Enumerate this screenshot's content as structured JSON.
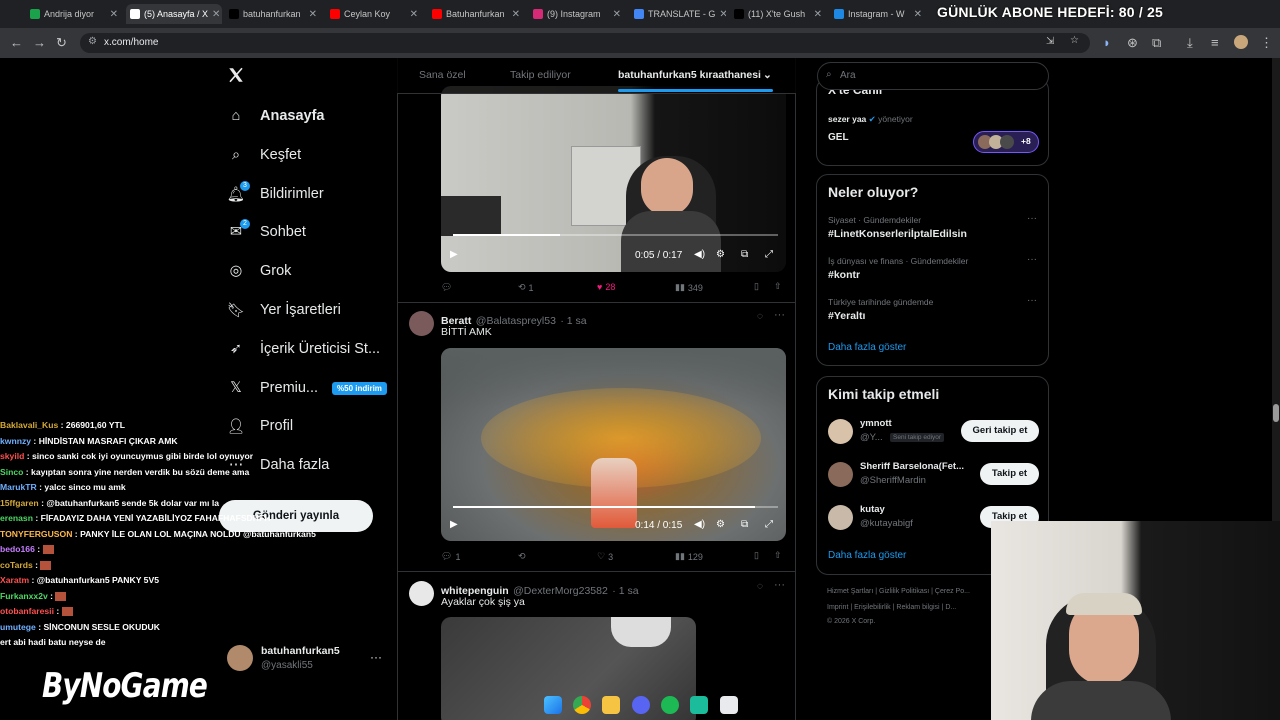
{
  "browser": {
    "tabs": [
      {
        "label": "Andrija diyor",
        "color": "#1aa34a"
      },
      {
        "label": "(5) Anasayfa / X",
        "color": "#ffffff",
        "active": true
      },
      {
        "label": "batuhanfurkan",
        "color": "#000000"
      },
      {
        "label": "Ceylan Koy",
        "color": "#ff0000"
      },
      {
        "label": "Batuhanfurkan",
        "color": "#ff0000"
      },
      {
        "label": "(9) Instagram",
        "color": "#d62976"
      },
      {
        "label": "TRANSLATE - G",
        "color": "#4285f4"
      },
      {
        "label": "(11) X'te Gush",
        "color": "#000000"
      },
      {
        "label": "Instagram - W",
        "color": "#1e88e5"
      }
    ],
    "url": "x.com/home",
    "overlay_goal": "GÜNLÜK ABONE HEDEFİ: 80 / 25"
  },
  "nav": {
    "items": [
      {
        "label": "Anasayfa",
        "icon": "home-icon"
      },
      {
        "label": "Keşfet",
        "icon": "search-icon"
      },
      {
        "label": "Bildirimler",
        "icon": "bell-icon",
        "count": "3"
      },
      {
        "label": "Sohbet",
        "icon": "chat-icon",
        "count": "2"
      },
      {
        "label": "Grok",
        "icon": "grok-icon"
      },
      {
        "label": "Yer İşaretleri",
        "icon": "bookmark-icon"
      },
      {
        "label": "İçerik Üreticisi St...",
        "icon": "rocket-icon"
      },
      {
        "label": "Premiu...",
        "icon": "x-icon",
        "badge": "%50 indirim"
      },
      {
        "label": "Profil",
        "icon": "person-icon"
      },
      {
        "label": "Daha fazla",
        "icon": "more-icon"
      }
    ],
    "post_button": "Gönderi yayınla",
    "account": {
      "name": "batuhanfurkan5",
      "handle": "@yasakli55"
    }
  },
  "feed": {
    "tabs": [
      "Sana özel",
      "Takip ediliyor",
      "batuhanfurkan5 kıraathanesi"
    ],
    "post1": {
      "time": "0:05 / 0:17",
      "replies": "",
      "reposts": "1",
      "likes": "28",
      "views": "349"
    },
    "post2": {
      "name": "Beratt",
      "handle": "@Balataspreyl53",
      "age": "· 1 sa",
      "text": "BİTTİ AMK",
      "time": "0:14 / 0:15",
      "replies": "1",
      "reposts": "",
      "likes": "3",
      "views": "129"
    },
    "post3": {
      "name": "whitepenguin",
      "handle": "@DexterMorg23582",
      "age": "· 1 sa",
      "text": "Ayaklar çok şiş ya"
    }
  },
  "sidebar": {
    "search_placeholder": "Ara",
    "space": {
      "title": "X'te Canlı",
      "host": "sezer yaa",
      "host_role": "yönetiyor",
      "name": "GEL",
      "extra": "+8"
    },
    "trends": {
      "title": "Neler oluyor?",
      "items": [
        {
          "meta": "Siyaset · Gündemdekiler",
          "tag": "#LinetKonserleriİptalEdilsin"
        },
        {
          "meta": "İş dünyası ve finans · Gündemdekiler",
          "tag": "#kontr"
        },
        {
          "meta": "Türkiye tarihinde gündemde",
          "tag": "#Yeraltı"
        }
      ],
      "more": "Daha fazla göster"
    },
    "follow": {
      "title": "Kimi takip etmeli",
      "items": [
        {
          "name": "ymnott",
          "handle": "@Y...",
          "tag": "Seni takip ediyor",
          "button": "Geri takip et"
        },
        {
          "name": "Sheriff Barselona(Fet...",
          "handle": "@SheriffMardin",
          "tag": "",
          "button": "Takip et"
        },
        {
          "name": "kutay",
          "handle": "@kutayabigf",
          "tag": "",
          "button": "Takip et"
        }
      ],
      "more": "Daha fazla göster"
    },
    "footer": {
      "line1": [
        "Hizmet Şartları",
        "Gizlilik Politikası",
        "Çerez Po..."
      ],
      "line2": [
        "Imprint",
        "Erişilebilirlik",
        "Reklam bilgisi",
        "D..."
      ],
      "copyright": "© 2026 X Corp."
    }
  },
  "stream": {
    "chat": [
      {
        "user": "Baklavali_Kus",
        "color": "#d4a93b",
        "msg": "266901,60 YTL"
      },
      {
        "user": "kwnnzy",
        "color": "#6fb0ff",
        "msg": "HİNDİSTAN MASRAFI ÇIKAR AMK"
      },
      {
        "user": "skyild",
        "color": "#ff5050",
        "msg": "sinco sanki cok iyi oyuncuymus gibi birde lol oynuyor"
      },
      {
        "user": "Sinco",
        "color": "#4cd964",
        "msg": "kayıptan sonra yine nerden verdik bu sözü deme ama"
      },
      {
        "user": "MarukTR",
        "color": "#6fb0ff",
        "msg": "yalcc sinco mu amk"
      },
      {
        "user": "15ffgaren",
        "color": "#d4a93b",
        "msg": "@batuhanfurkan5 sende 5k dolar var mı la"
      },
      {
        "user": "erenasn",
        "color": "#4cd964",
        "msg": "FİFADAYIZ DAHA YENİ YAZABİLİYOZ FAHAFHAFSDHFH"
      },
      {
        "user": "TONYFERGUSON",
        "color": "#ffb84d",
        "msg": "PANKY İLE OLAN LOL MAÇINA NOLDU @batuhanfurkan5"
      },
      {
        "user": "bedo166",
        "color": "#c77dff",
        "msg": ""
      },
      {
        "user": "coTards",
        "color": "#d4a93b",
        "msg": ""
      },
      {
        "user": "Xaratm",
        "color": "#ff5050",
        "msg": "@batuhanfurkan5 PANKY 5V5"
      },
      {
        "user": "Furkanxx2v",
        "color": "#4cd964",
        "msg": ""
      },
      {
        "user": "otobanfaresii",
        "color": "#ff5050",
        "msg": ""
      },
      {
        "user": "umutege",
        "color": "#6fb0ff",
        "msg": "SİNCONUN SESLE OKUDUK"
      },
      {
        "user": "",
        "color": "#ffffff",
        "msg": "ert abi hadi batu neyse de"
      }
    ],
    "logo": "ByNoGame"
  },
  "colors": {
    "accent": "#1d9bf0",
    "like": "#f91880",
    "bg": "#000000",
    "border": "#2f3336"
  }
}
